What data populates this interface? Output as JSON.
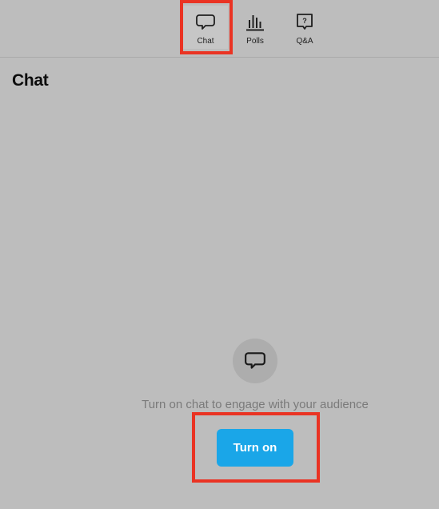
{
  "tabs": [
    {
      "id": "chat",
      "label": "Chat",
      "icon": "speech-bubble-icon",
      "active": true
    },
    {
      "id": "polls",
      "label": "Polls",
      "icon": "bar-chart-icon",
      "active": false
    },
    {
      "id": "qa",
      "label": "Q&A",
      "icon": "question-bubble-icon",
      "active": false
    }
  ],
  "panel": {
    "title": "Chat",
    "empty_state_icon": "speech-bubble-icon",
    "hint": "Turn on chat to engage with your audience",
    "turn_on_label": "Turn on"
  },
  "colors": {
    "background": "#bdbdbd",
    "button": "#1aa6e8",
    "highlight": "#ea3323"
  }
}
